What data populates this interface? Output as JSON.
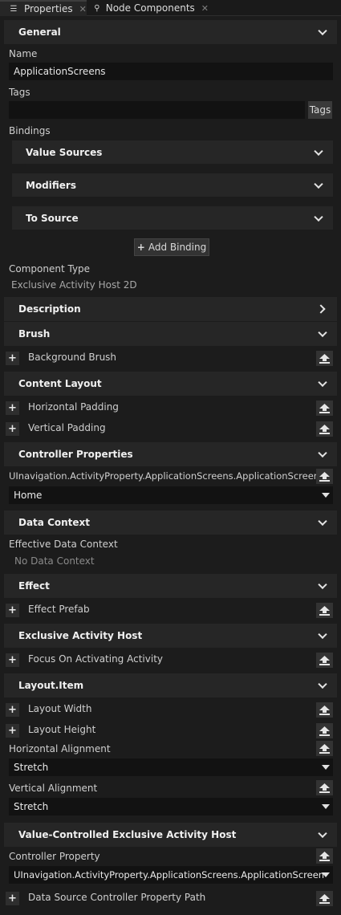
{
  "tabs": [
    {
      "label": "Properties",
      "icon": "list-icon",
      "active": true
    },
    {
      "label": "Node Components",
      "icon": "nodes-icon",
      "active": false
    }
  ],
  "general": {
    "title": "General",
    "name_label": "Name",
    "name_value": "ApplicationScreens",
    "tags_label": "Tags",
    "tags_value": "",
    "tags_button": "Tags",
    "bindings_label": "Bindings",
    "value_sources": "Value Sources",
    "modifiers": "Modifiers",
    "to_source": "To Source",
    "add_binding": "Add Binding",
    "component_type_label": "Component Type",
    "component_type_value": "Exclusive Activity Host 2D"
  },
  "description": {
    "title": "Description"
  },
  "brush": {
    "title": "Brush",
    "background_brush": "Background Brush"
  },
  "content_layout": {
    "title": "Content Layout",
    "horizontal_padding": "Horizontal Padding",
    "vertical_padding": "Vertical Padding"
  },
  "controller_properties": {
    "title": "Controller Properties",
    "property_label": "UInavigation.ActivityProperty.ApplicationScreens.ApplicationScreen",
    "property_value": "Home"
  },
  "data_context": {
    "title": "Data Context",
    "effective_label": "Effective Data Context",
    "effective_value": "No Data Context"
  },
  "effect": {
    "title": "Effect",
    "effect_prefab": "Effect Prefab"
  },
  "exclusive_activity_host": {
    "title": "Exclusive Activity Host",
    "focus_on_activating": "Focus On Activating Activity"
  },
  "layout_item": {
    "title": "Layout.Item",
    "layout_width": "Layout Width",
    "layout_height": "Layout Height",
    "horizontal_alignment_label": "Horizontal Alignment",
    "horizontal_alignment_value": "Stretch",
    "vertical_alignment_label": "Vertical Alignment",
    "vertical_alignment_value": "Stretch"
  },
  "value_controlled": {
    "title": "Value-Controlled Exclusive Activity Host",
    "controller_property_label": "Controller Property",
    "controller_property_value": "UInavigation.ActivityProperty.ApplicationScreens.ApplicationScreen",
    "data_source_path": "Data Source Controller Property Path"
  }
}
